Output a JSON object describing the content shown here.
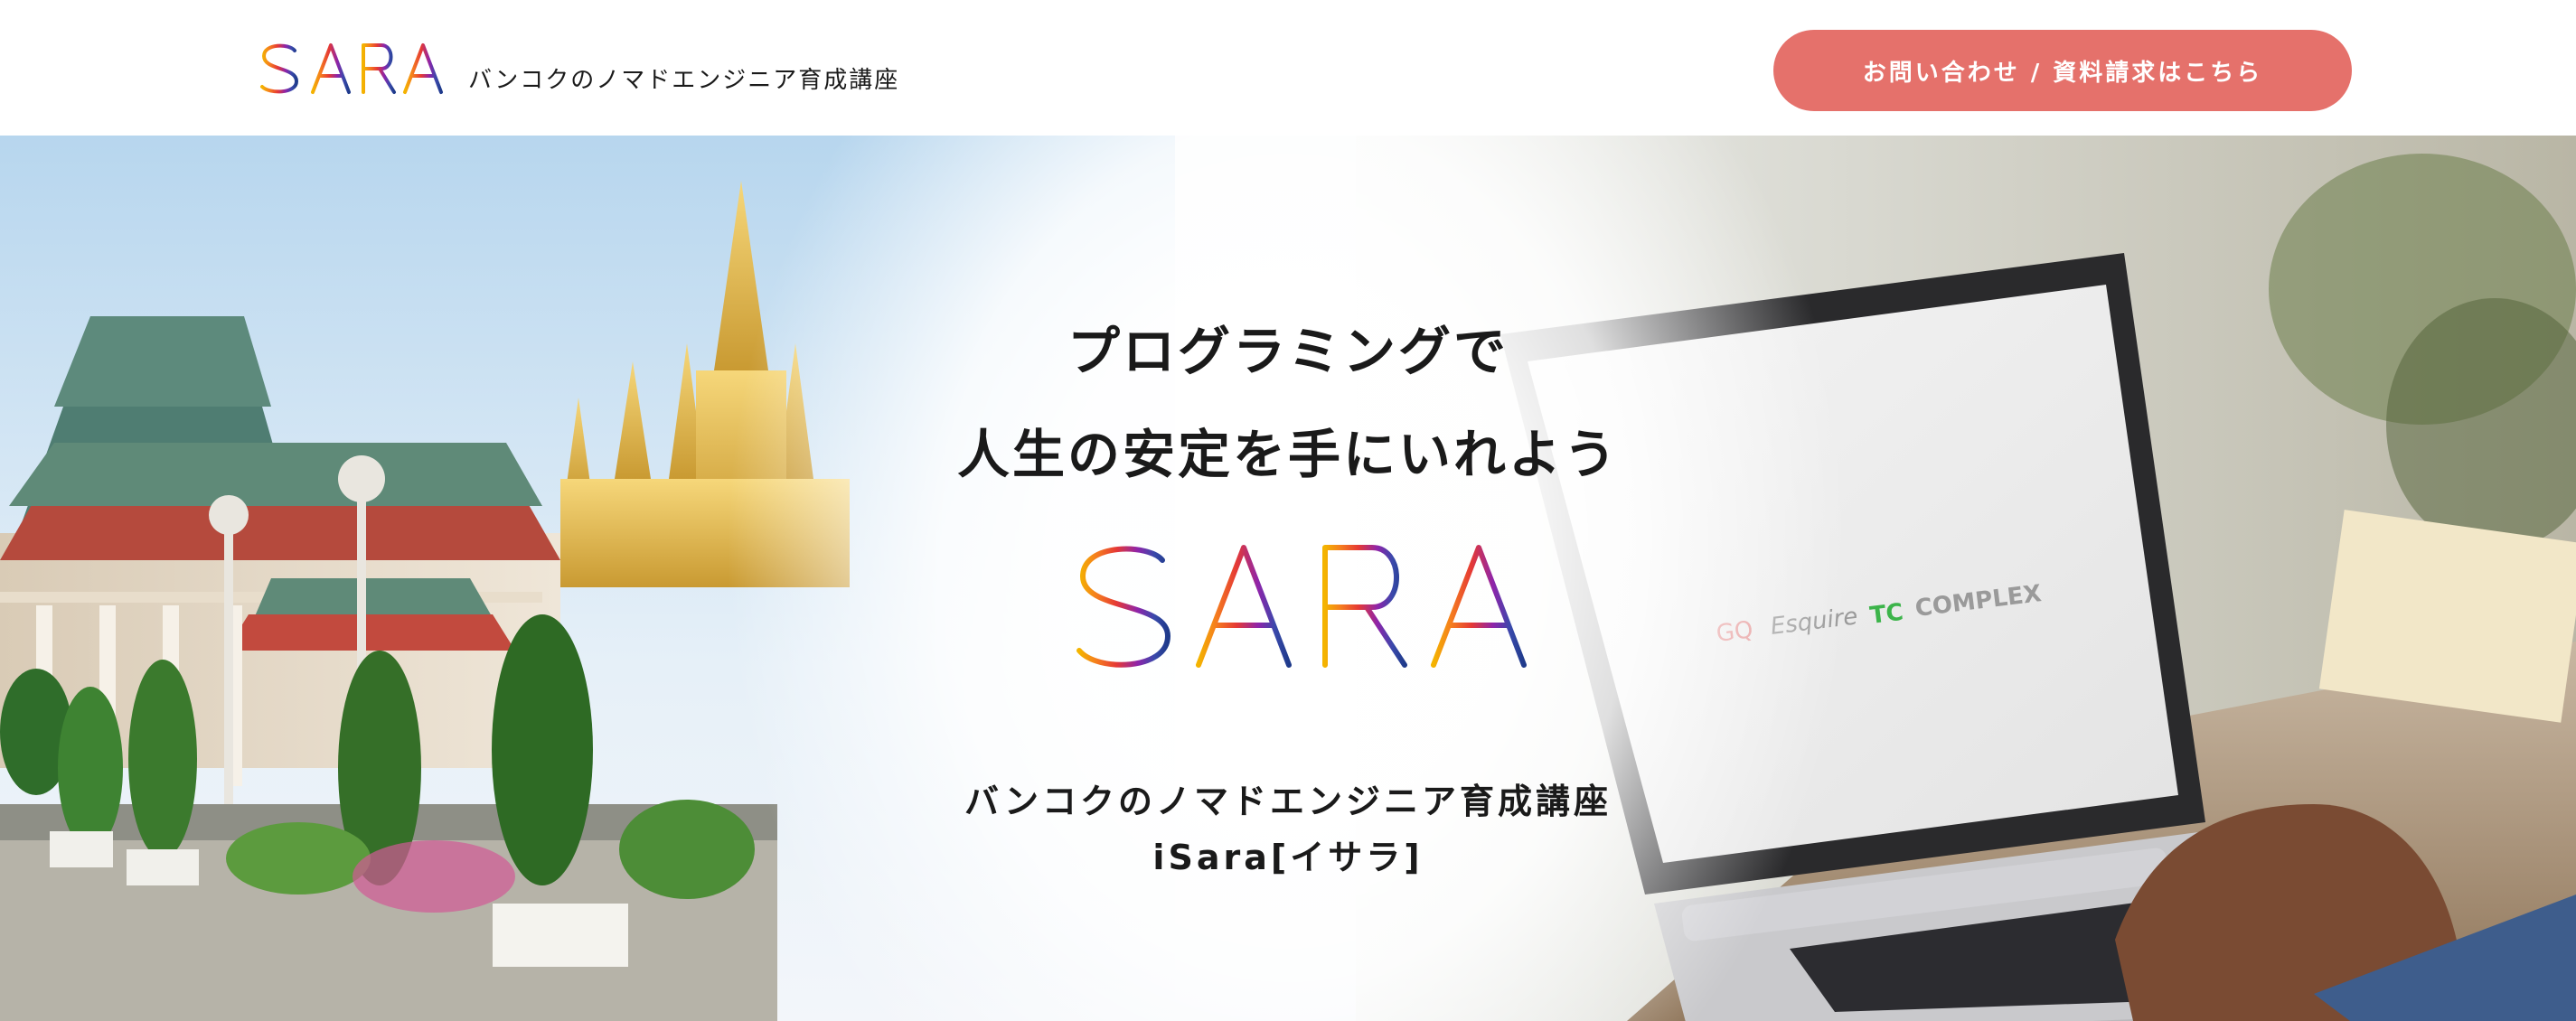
{
  "header": {
    "logo_text": "iSARA",
    "tagline": "バンコクのノマドエンジニア育成講座",
    "cta_label": "お問い合わせ / 資料請求はこちら"
  },
  "hero": {
    "headline_line1": "プログラミングで",
    "headline_line2": "人生の安定を手にいれよう",
    "logo_text": "iSARA",
    "sub_line1": "バンコクのノマドエンジニア育成講座",
    "sub_line2": "iSara[イサラ]",
    "screen_brands": [
      "GQ",
      "Esquire",
      "TC",
      "COMPLEX"
    ]
  },
  "colors": {
    "cta": "#e5716b",
    "logo_gradient": [
      "#f4b400",
      "#f57c1f",
      "#e53935",
      "#8e24aa",
      "#3949ab",
      "#1e3a8a"
    ]
  }
}
